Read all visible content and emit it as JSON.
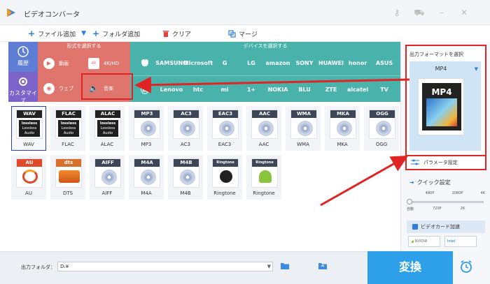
{
  "app": {
    "title": "ビデオコンバータ"
  },
  "toolbar": {
    "add_file": "ファイル追加",
    "add_folder": "フォルダ追加",
    "clear": "クリア",
    "merge": "マージ"
  },
  "side": {
    "history": "履歴",
    "customize": "カスタマイズ"
  },
  "categories": {
    "format_header": "形式を選択する",
    "device_header": "デバイスを選択する",
    "formats": [
      {
        "label": "動画"
      },
      {
        "label": "4K/HD"
      },
      {
        "label": "ウェブ"
      },
      {
        "label": "音楽"
      }
    ],
    "devices_row1": [
      "",
      "SAMSUNG",
      "Microsoft",
      "G",
      "LG",
      "amazon",
      "SONY",
      "HUAWEI",
      "honor",
      "ASUS"
    ],
    "devices_row2": [
      "",
      "Lenovo",
      "htc",
      "mi",
      "1+",
      "NOKIA",
      "BLU",
      "ZTE",
      "alcatel",
      "TV"
    ]
  },
  "formats": [
    {
      "badge": "WAV",
      "name": "WAV",
      "color": "#222222",
      "type": "lossless"
    },
    {
      "badge": "FLAC",
      "name": "FLAC",
      "color": "#222222",
      "type": "lossless"
    },
    {
      "badge": "ALAC",
      "name": "ALAC",
      "color": "#222222",
      "type": "lossless"
    },
    {
      "badge": "MP3",
      "name": "MP3",
      "color": "#3d4656",
      "type": "disc"
    },
    {
      "badge": "AC3",
      "name": "AC3",
      "color": "#3d4656",
      "type": "disc"
    },
    {
      "badge": "EAC3",
      "name": "EAC3",
      "color": "#3d4656",
      "type": "disc"
    },
    {
      "badge": "AAC",
      "name": "AAC",
      "color": "#3d4656",
      "type": "disc"
    },
    {
      "badge": "WMA",
      "name": "WMA",
      "color": "#3d4656",
      "type": "disc"
    },
    {
      "badge": "MKA",
      "name": "MKA",
      "color": "#3d4656",
      "type": "disc"
    },
    {
      "badge": "OGG",
      "name": "OGG",
      "color": "#3d4656",
      "type": "disc"
    },
    {
      "badge": "AU",
      "name": "AU",
      "color": "#e04a2a",
      "type": "au"
    },
    {
      "badge": "dts",
      "name": "DTS",
      "color": "#d8702a",
      "type": "dts"
    },
    {
      "badge": "AIFF",
      "name": "AIFF",
      "color": "#3d4656",
      "type": "disc"
    },
    {
      "badge": "M4A",
      "name": "M4A",
      "color": "#3d4656",
      "type": "disc"
    },
    {
      "badge": "M4B",
      "name": "M4B",
      "color": "#3d4656",
      "type": "disc"
    },
    {
      "badge": "Ringtone",
      "name": "Ringtone",
      "color": "#3d4656",
      "type": "ring-apple"
    },
    {
      "badge": "Ringtone",
      "name": "Ringtone",
      "color": "#3d4656",
      "type": "ring-android"
    }
  ],
  "output": {
    "label": "出力フォーマットを選択",
    "selected": "MP4",
    "icon_text": "MP4",
    "param_label": "パラメータ設定"
  },
  "quick": {
    "label": "クイック設定",
    "top_ticks": [
      "480P",
      "1080P",
      "4K"
    ],
    "bottom_ticks": [
      "自動",
      "720P",
      "2K"
    ],
    "level": 0
  },
  "gpu": {
    "label": "ビデオカード加速",
    "nvidia": "NVIDIA",
    "intel": "Intel"
  },
  "bottom": {
    "folder_label": "出力フォルダ：",
    "folder_value": "D:¥",
    "convert": "変換"
  },
  "colors": {
    "accent": "#2ea0ea",
    "highlight": "#e02424",
    "device_bg": "#49b3ab",
    "format_bg": "#e0756e",
    "side_bg": "#5e7dd5"
  }
}
